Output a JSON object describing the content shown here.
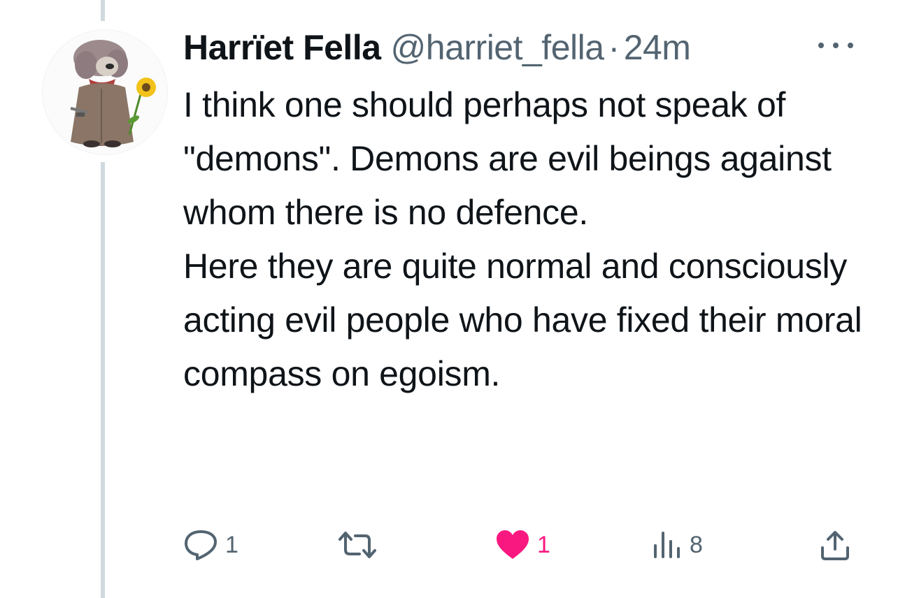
{
  "tweet": {
    "display_name": "Harrïet Fella",
    "handle": "@harriet_fella",
    "separator": "·",
    "time": "24m",
    "avatar_icon": "avatar-with-sunflower-icon",
    "paragraphs": [
      "I think one should perhaps not speak of \"demons\". Demons are evil beings against whom there is no defence.",
      "Here they are quite normal and consciously acting evil people who have fixed their moral compass on egoism."
    ]
  },
  "actions": {
    "reply": {
      "icon": "reply-icon",
      "count": "1"
    },
    "retweet": {
      "icon": "retweet-icon",
      "count": ""
    },
    "like": {
      "icon": "heart-icon",
      "count": "1",
      "liked": true
    },
    "views": {
      "icon": "views-icon",
      "count": "8"
    },
    "share": {
      "icon": "share-icon"
    }
  },
  "colors": {
    "text_primary": "#0f1419",
    "text_secondary": "#536471",
    "like": "#f91880",
    "thread_line": "#cfd9de"
  }
}
